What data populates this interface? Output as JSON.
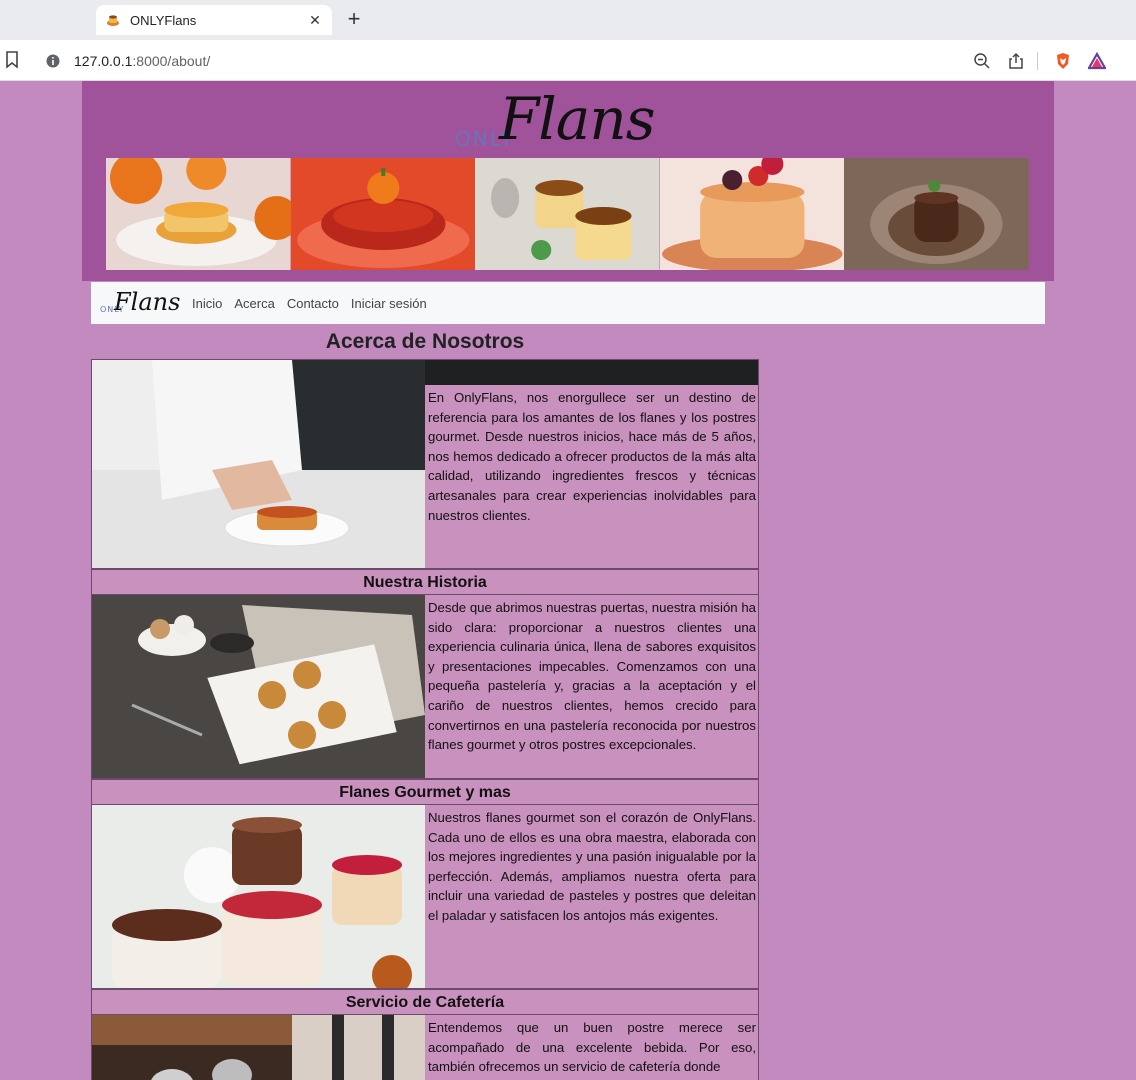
{
  "browser": {
    "tab_title": "ONLYFlans",
    "url_host": "127.0.0.1",
    "url_rest": ":8000/about/"
  },
  "header": {
    "logo_only": "ONLY",
    "logo_flans": "Flans",
    "banner_images": [
      "flan-orange-photo",
      "flan-pumpkin-photo",
      "flan-duo-photo",
      "flan-berries-photo",
      "flan-chocolate-photo"
    ]
  },
  "nav": {
    "logo_only": "ONLY",
    "logo_flans": "Flans",
    "links": [
      "Inicio",
      "Acerca",
      "Contacto",
      "Iniciar sesión"
    ]
  },
  "page": {
    "title": "Acerca de Nosotros",
    "sections": [
      {
        "heading": "",
        "image": "chef-plating-flan-photo",
        "text": "En OnlyFlans, nos enorgullece ser un destino de referencia para los amantes de los flanes y los postres gourmet. Desde nuestros inicios, hace más de 5 años, nos hemos dedicado a ofrecer productos de la más alta calidad, utilizando ingredientes frescos y técnicas artesanales para crear experiencias inolvidables para nuestros clientes."
      },
      {
        "heading": "Nuestra Historia",
        "image": "flans-on-tray-photo",
        "text": "Desde que abrimos nuestras puertas, nuestra misión ha sido clara: proporcionar a nuestros clientes una experiencia culinaria única, llena de sabores exquisitos y presentaciones impecables. Comenzamos con una pequeña pastelería y, gracias a la aceptación y el cariño de nuestros clientes, hemos crecido para convertirnos en una pastelería reconocida por nuestros flanes gourmet y otros postres excepcionales."
      },
      {
        "heading": "Flanes Gourmet y mas",
        "image": "gourmet-cakes-photo",
        "text": "Nuestros flanes gourmet son el corazón de OnlyFlans. Cada uno de ellos es una obra maestra, elaborada con los mejores ingredientes y una pasión inigualable por la perfección. Además, ampliamos nuestra oferta para incluir una variedad de pasteles y postres que deleitan el paladar y satisfacen los antojos más exigentes."
      },
      {
        "heading": "Servicio de Cafetería",
        "image": "coffee-shop-photo",
        "text": "Entendemos que un buen postre merece ser acompañado de una excelente bebida. Por eso, también ofrecemos un servicio de cafetería donde"
      }
    ]
  },
  "colors": {
    "page_bg": "#c28abf",
    "header_bg": "#a0529b",
    "section_bg": "#c991bd",
    "logo_only": "#6576b9"
  }
}
